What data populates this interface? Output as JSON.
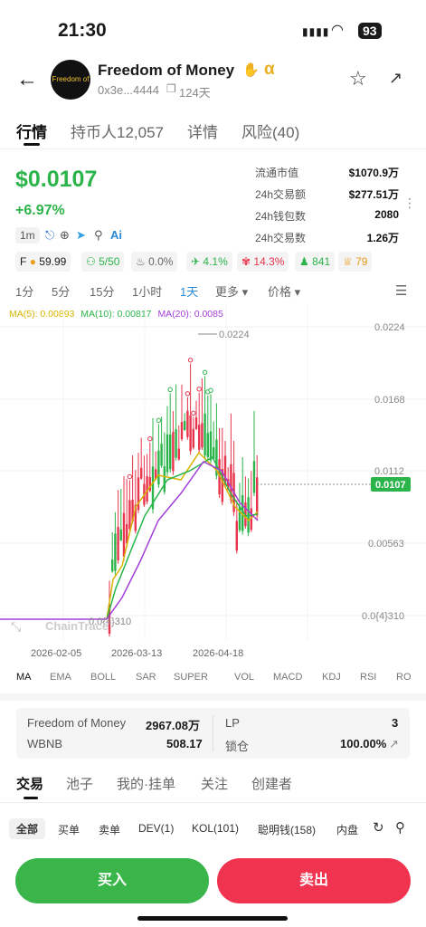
{
  "status": {
    "time": "21:30",
    "battery": "93"
  },
  "header": {
    "name": "Freedom of Money",
    "alpha": "α",
    "address": "0x3e...4444",
    "age": "124天",
    "avatar_text": "Freedom of Money"
  },
  "tabs": [
    "行情",
    "持币人12,057",
    "详情",
    "风险(40)"
  ],
  "price": {
    "value": "$0.0107",
    "change": "+6.97%",
    "interval": "1m"
  },
  "stats": [
    {
      "k": "流通市值",
      "v": "$1070.9万"
    },
    {
      "k": "24h交易额",
      "v": "$277.51万"
    },
    {
      "k": "24h钱包数",
      "v": "2080"
    },
    {
      "k": "24h交易数",
      "v": "1.26万"
    }
  ],
  "chips": [
    {
      "label": "F",
      "value": "59.99",
      "color": "#1a1a1a"
    },
    {
      "label": "5/50",
      "color": "#2bb44a"
    },
    {
      "label": "0.0%",
      "color": "#666"
    },
    {
      "label": "4.1%",
      "color": "#2bb44a"
    },
    {
      "label": "14.3%",
      "color": "#e8344c"
    },
    {
      "label": "841",
      "color": "#2bb44a"
    },
    {
      "label": "79",
      "color": "#e89a1c"
    }
  ],
  "timeframes": [
    "1分",
    "5分",
    "15分",
    "1小时",
    "1天",
    "更多",
    "价格"
  ],
  "ma_legend": {
    "ma5": "MA(5): 0.00893",
    "ma10": "MA(10): 0.00817",
    "ma20": "MA(20): 0.0085"
  },
  "chart_data": {
    "type": "candlestick",
    "y_ticks": [
      "0.0224",
      "0.0168",
      "0.0112",
      "0.00563",
      "0.0{4}310"
    ],
    "x_ticks": [
      "2026-02-05",
      "2026-03-13",
      "2026-04-18"
    ],
    "current": "0.0107",
    "high_label": "0.0224",
    "low_label": "0.0{4}310",
    "watermark": "ChainTrace"
  },
  "indicators": [
    "MA",
    "EMA",
    "BOLL",
    "SAR",
    "SUPER",
    "VOL",
    "MACD",
    "KDJ",
    "RSI",
    "RO"
  ],
  "pool": {
    "token": "Freedom of Money",
    "token_amt": "2967.08万",
    "base": "WBNB",
    "base_amt": "508.17",
    "lp": "LP",
    "lp_val": "3",
    "lock": "锁仓",
    "lock_val": "100.00%"
  },
  "tabs2": [
    "交易",
    "池子",
    "我的·挂单",
    "关注",
    "创建者"
  ],
  "filters": [
    "全部",
    "买单",
    "卖单",
    "DEV(1)",
    "KOL(101)",
    "聪明钱(158)",
    "内盘"
  ],
  "buttons": {
    "buy": "买入",
    "sell": "卖出"
  }
}
